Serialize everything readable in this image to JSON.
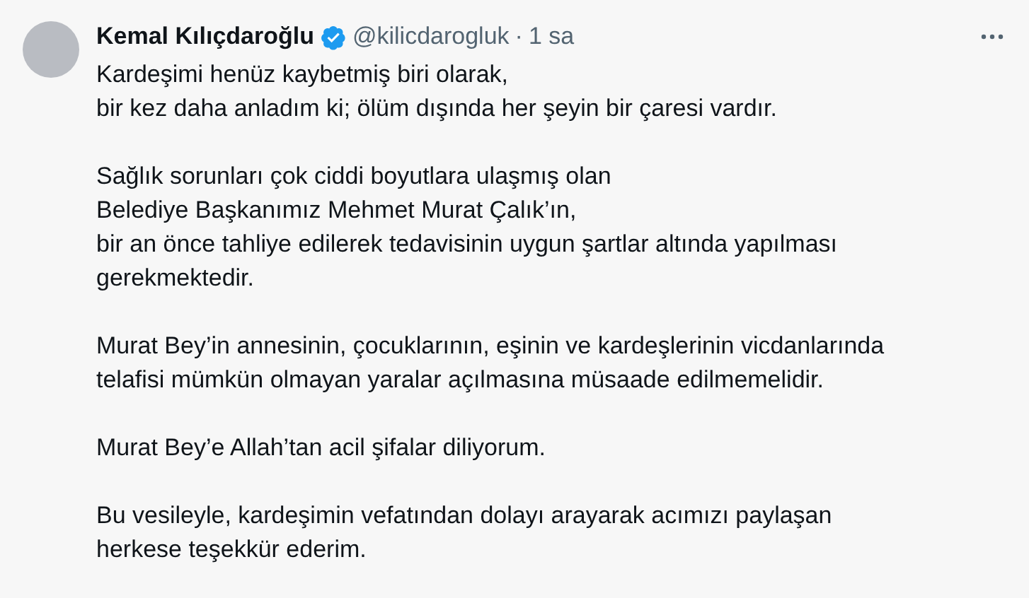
{
  "author": {
    "name": "Kemal Kılıçdaroğlu",
    "verified": true,
    "handle": "@kilicdarogluk",
    "separator": "·",
    "time": "1 sa"
  },
  "paragraphs": [
    [
      "Kardeşimi henüz kaybetmiş biri olarak,",
      "bir kez daha anladım ki; ölüm dışında her şeyin bir çaresi vardır."
    ],
    [
      "Sağlık sorunları çok ciddi boyutlara ulaşmış olan",
      "Belediye Başkanımız Mehmet Murat Çalık’ın,",
      "bir an önce tahliye edilerek tedavisinin uygun şartlar altında yapılması",
      "gerekmektedir."
    ],
    [
      "Murat Bey’in annesinin, çocuklarının, eşinin ve kardeşlerinin vicdanlarında",
      "telafisi mümkün olmayan yaralar açılmasına müsaade edilmemelidir."
    ],
    [
      "Murat Bey’e Allah’tan acil şifalar diliyorum."
    ],
    [
      "Bu vesileyle, kardeşimin vefatından dolayı arayarak acımızı paylaşan",
      "herkese teşekkür ederim."
    ]
  ]
}
